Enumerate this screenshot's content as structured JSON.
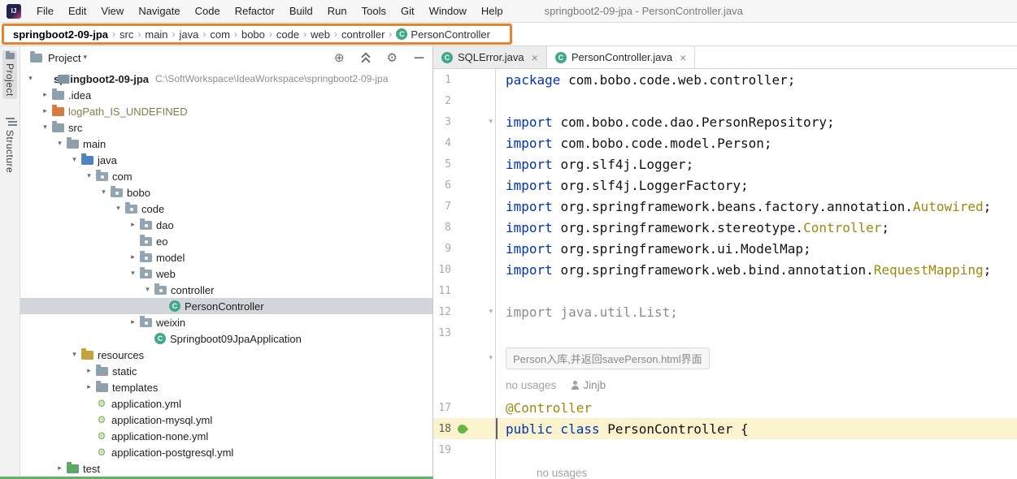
{
  "colors": {
    "annotation_orange": "#E8832C",
    "keyword_blue": "#0033B3",
    "metadata_olive": "#9E880D",
    "spring_green": "#6DB33F",
    "class_icon_teal": "#41A88A",
    "current_line": "#FAF3CE",
    "selection_gray": "#D2D6DB",
    "bottom_bar_green": "#5FB365"
  },
  "glyphs": {
    "chevron_down": "▾",
    "chevron_right": "▸",
    "breadcrumb_sep": "›",
    "tab_close": "×",
    "locate": "⊕",
    "gear": "⚙",
    "hide": "—",
    "class_letter": "C",
    "yml": "⚙",
    "fold": "▾",
    "header_caret": "▾"
  },
  "title_bar": {
    "logo_text": "IJ",
    "menus": [
      "File",
      "Edit",
      "View",
      "Navigate",
      "Code",
      "Refactor",
      "Build",
      "Run",
      "Tools",
      "Git",
      "Window",
      "Help"
    ],
    "window_title": "springboot2-09-jpa - PersonController.java"
  },
  "breadcrumbs": {
    "items": [
      {
        "label": "springboot2-09-jpa",
        "bold": true
      },
      {
        "label": "src"
      },
      {
        "label": "main"
      },
      {
        "label": "java"
      },
      {
        "label": "com"
      },
      {
        "label": "bobo"
      },
      {
        "label": "code"
      },
      {
        "label": "web"
      },
      {
        "label": "controller"
      },
      {
        "label": "PersonController",
        "icon": "class"
      }
    ]
  },
  "tool_stripe": {
    "items": [
      {
        "label": "Project",
        "active": true
      },
      {
        "label": "Structure",
        "active": false
      }
    ]
  },
  "project_panel": {
    "title": "Project",
    "tree": [
      {
        "label": "springboot2-09-jpa",
        "hint": "C:\\SoftWorkspace\\IdeaWorkspace\\springboot2-09-jpa",
        "level": 0,
        "chevron": "down",
        "icon": "project",
        "bold": true
      },
      {
        "label": ".idea",
        "level": 1,
        "chevron": "right",
        "icon": "folder"
      },
      {
        "label": "logPath_IS_UNDEFINED",
        "level": 1,
        "chevron": "right",
        "icon": "folder-excluded",
        "muted": true
      },
      {
        "label": "src",
        "level": 1,
        "chevron": "down",
        "icon": "folder"
      },
      {
        "label": "main",
        "level": 2,
        "chevron": "down",
        "icon": "folder"
      },
      {
        "label": "java",
        "level": 3,
        "chevron": "down",
        "icon": "folder-src"
      },
      {
        "label": "com",
        "level": 4,
        "chevron": "down",
        "icon": "package"
      },
      {
        "label": "bobo",
        "level": 5,
        "chevron": "down",
        "icon": "package"
      },
      {
        "label": "code",
        "level": 6,
        "chevron": "down",
        "icon": "package"
      },
      {
        "label": "dao",
        "level": 7,
        "chevron": "right",
        "icon": "package"
      },
      {
        "label": "eo",
        "level": 7,
        "chevron": "none",
        "icon": "package"
      },
      {
        "label": "model",
        "level": 7,
        "chevron": "right",
        "icon": "package"
      },
      {
        "label": "web",
        "level": 7,
        "chevron": "down",
        "icon": "package"
      },
      {
        "label": "controller",
        "level": 8,
        "chevron": "down",
        "icon": "package"
      },
      {
        "label": "PersonController",
        "level": 9,
        "chevron": "none",
        "icon": "class",
        "selected": true
      },
      {
        "label": "weixin",
        "level": 7,
        "chevron": "right",
        "icon": "package"
      },
      {
        "label": "Springboot09JpaApplication",
        "level": 8,
        "chevron": "none",
        "icon": "class"
      },
      {
        "label": "resources",
        "level": 3,
        "chevron": "down",
        "icon": "folder-res"
      },
      {
        "label": "static",
        "level": 4,
        "chevron": "right",
        "icon": "folder"
      },
      {
        "label": "templates",
        "level": 4,
        "chevron": "right",
        "icon": "folder"
      },
      {
        "label": "application.yml",
        "level": 4,
        "chevron": "none",
        "icon": "yml"
      },
      {
        "label": "application-mysql.yml",
        "level": 4,
        "chevron": "none",
        "icon": "yml"
      },
      {
        "label": "application-none.yml",
        "level": 4,
        "chevron": "none",
        "icon": "yml"
      },
      {
        "label": "application-postgresql.yml",
        "level": 4,
        "chevron": "none",
        "icon": "yml"
      },
      {
        "label": "test",
        "level": 2,
        "chevron": "right",
        "icon": "folder-test"
      }
    ]
  },
  "editor": {
    "tabs": [
      {
        "label": "SQLError.java",
        "icon": "class",
        "active": false
      },
      {
        "label": "PersonController.java",
        "icon": "class",
        "active": true
      }
    ],
    "lines": [
      {
        "num": "1",
        "segs": [
          {
            "c": "kw",
            "t": "package "
          },
          {
            "c": "pl",
            "t": "com.bobo.code.web.controller;"
          }
        ]
      },
      {
        "num": "2",
        "segs": []
      },
      {
        "num": "3",
        "fold": true,
        "segs": [
          {
            "c": "kw",
            "t": "import "
          },
          {
            "c": "pl",
            "t": "com.bobo.code.dao.PersonRepository;"
          }
        ]
      },
      {
        "num": "4",
        "segs": [
          {
            "c": "kw",
            "t": "import "
          },
          {
            "c": "pl",
            "t": "com.bobo.code.model.Person;"
          }
        ]
      },
      {
        "num": "5",
        "segs": [
          {
            "c": "kw",
            "t": "import "
          },
          {
            "c": "pl",
            "t": "org.slf4j.Logger;"
          }
        ]
      },
      {
        "num": "6",
        "segs": [
          {
            "c": "kw",
            "t": "import "
          },
          {
            "c": "pl",
            "t": "org.slf4j.LoggerFactory;"
          }
        ]
      },
      {
        "num": "7",
        "segs": [
          {
            "c": "kw",
            "t": "import "
          },
          {
            "c": "pl",
            "t": "org.springframework.beans.factory.annotation."
          },
          {
            "c": "ann",
            "t": "Autowired"
          },
          {
            "c": "pl",
            "t": ";"
          }
        ]
      },
      {
        "num": "8",
        "segs": [
          {
            "c": "kw",
            "t": "import "
          },
          {
            "c": "pl",
            "t": "org.springframework.stereotype."
          },
          {
            "c": "ann",
            "t": "Controller"
          },
          {
            "c": "pl",
            "t": ";"
          }
        ]
      },
      {
        "num": "9",
        "segs": [
          {
            "c": "kw",
            "t": "import "
          },
          {
            "c": "pl",
            "t": "org.springframework.ui.ModelMap;"
          }
        ]
      },
      {
        "num": "10",
        "segs": [
          {
            "c": "kw",
            "t": "import "
          },
          {
            "c": "pl",
            "t": "org.springframework.web.bind.annotation."
          },
          {
            "c": "ann",
            "t": "RequestMapping"
          },
          {
            "c": "pl",
            "t": ";"
          }
        ]
      },
      {
        "num": "11",
        "segs": []
      },
      {
        "num": "12",
        "fold": true,
        "segs": [
          {
            "c": "gry",
            "t": "import java.util.List;"
          }
        ]
      },
      {
        "num": "13",
        "segs": []
      },
      {
        "type": "folded-comment",
        "text": "Person入库,并返回savePerson.html界面"
      },
      {
        "type": "inlay",
        "usages": "no usages",
        "author": "Jinjb"
      },
      {
        "num": "17",
        "segs": [
          {
            "c": "ann",
            "t": "@Controller"
          }
        ]
      },
      {
        "num": "18",
        "current": true,
        "gutter_icon": "spring",
        "segs": [
          {
            "c": "kw",
            "t": "public class "
          },
          {
            "c": "pl",
            "t": "PersonController {"
          }
        ]
      },
      {
        "num": "19",
        "segs": []
      },
      {
        "type": "inlay2",
        "usages": "no usages"
      }
    ]
  }
}
